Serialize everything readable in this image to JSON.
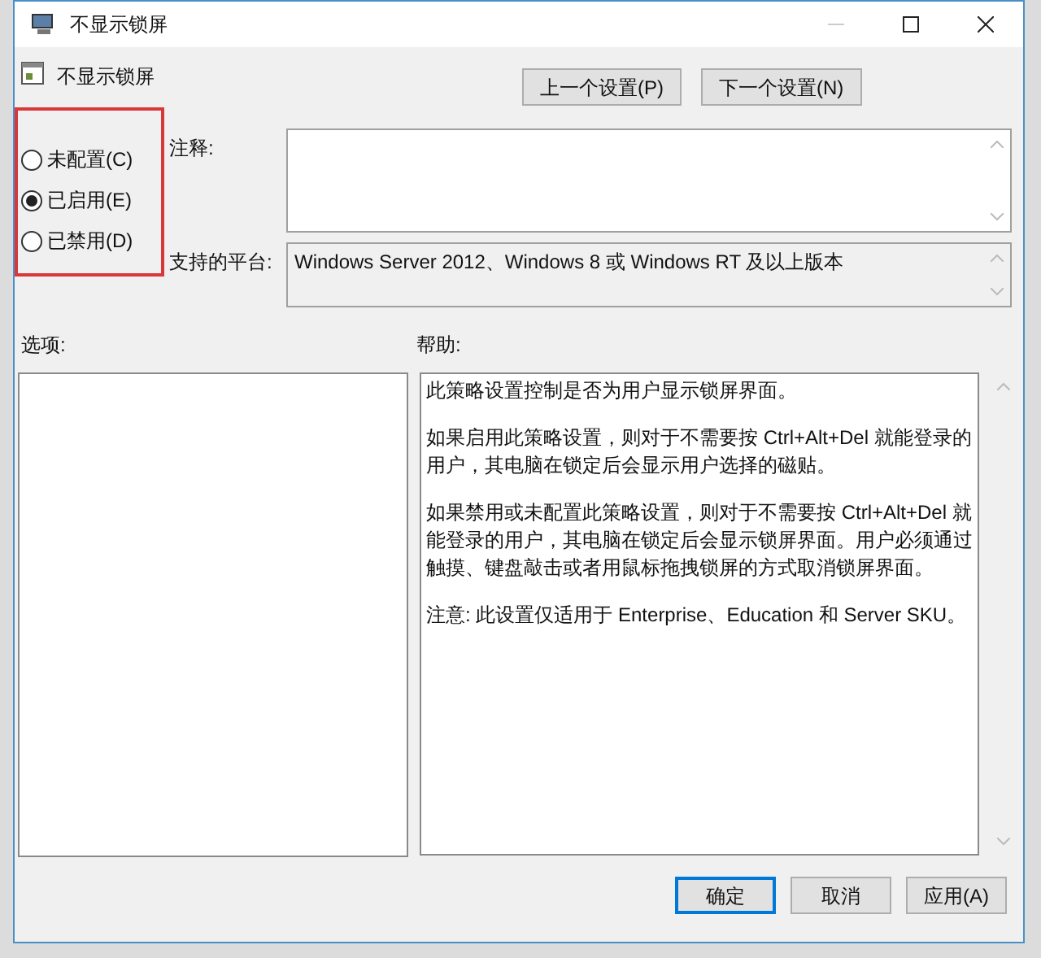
{
  "window": {
    "title": "不显示锁屏"
  },
  "setting_title": "不显示锁屏",
  "nav_buttons": [
    "上一个设置(P)",
    "下一个设置(N)"
  ],
  "options": [
    {
      "label": "未配置(C)",
      "selected": false
    },
    {
      "label": "已启用(E)",
      "selected": true
    },
    {
      "label": "已禁用(D)",
      "selected": false
    }
  ],
  "comment": {
    "label": "注释:"
  },
  "platform": {
    "label": "支持的平台:",
    "value": "Windows Server 2012、Windows 8 或 Windows RT 及以上版本"
  },
  "options_panel": {
    "label": "选项:"
  },
  "help": {
    "label": "帮助:",
    "paragraphs": [
      "此策略设置控制是否为用户显示锁屏界面。",
      "如果启用此策略设置，则对于不需要按 Ctrl+Alt+Del 就能登录的用户，其电脑在锁定后会显示用户选择的磁贴。",
      "如果禁用或未配置此策略设置，则对于不需要按 Ctrl+Alt+Del 就能登录的用户，其电脑在锁定后会显示锁屏界面。用户必须通过触摸、键盘敲击或者用鼠标拖拽锁屏的方式取消锁屏界面。",
      "注意: 此设置仅适用于 Enterprise、Education 和 Server SKU。"
    ]
  },
  "buttons": [
    {
      "label": "确定",
      "default": true
    },
    {
      "label": "取消",
      "default": false
    },
    {
      "label": "应用(A)",
      "default": false
    }
  ]
}
